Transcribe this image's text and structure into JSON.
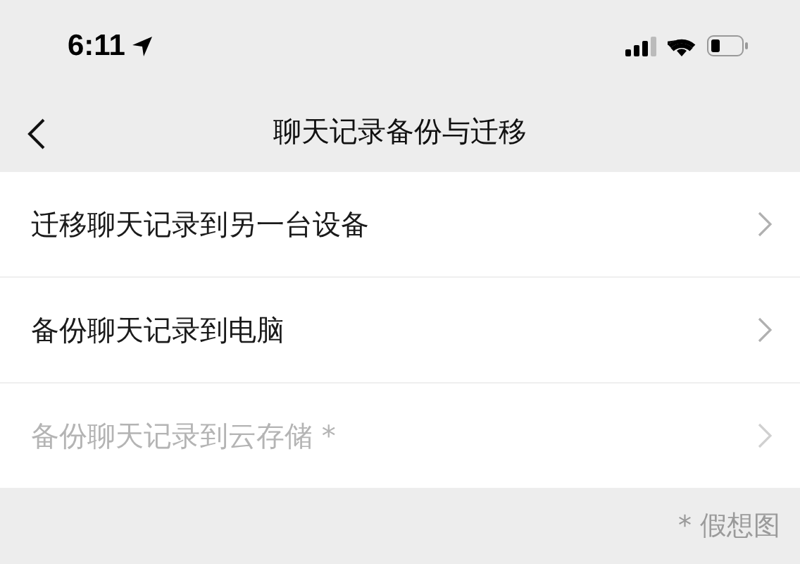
{
  "status_bar": {
    "time": "6:11"
  },
  "nav_bar": {
    "title": "聊天记录备份与迁移"
  },
  "items": [
    {
      "label": "迁移聊天记录到另一台设备",
      "disabled": false
    },
    {
      "label": "备份聊天记录到电脑",
      "disabled": false
    },
    {
      "label": "备份聊天记录到云存储 *",
      "disabled": true
    }
  ],
  "footnote": "* 假想图"
}
